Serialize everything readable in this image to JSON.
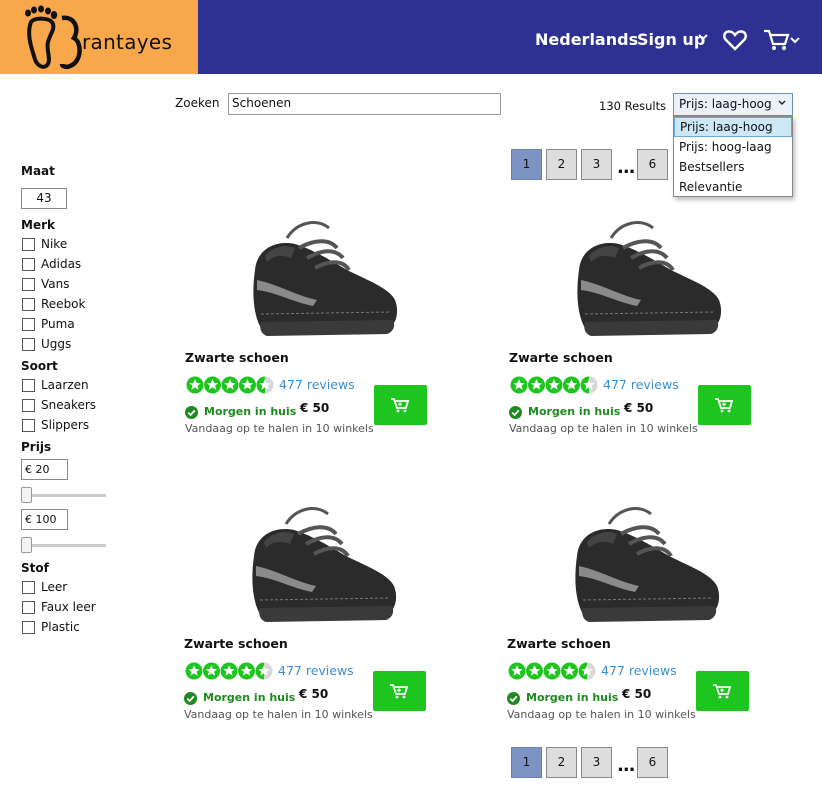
{
  "brand": {
    "name": "Brantayes",
    "letter": "B",
    "rest": "rantayes"
  },
  "nav": {
    "language": "Nederlands",
    "signup": "Sign up"
  },
  "icons": {
    "logo": "feet-logo-icon",
    "heart": "heart-icon",
    "cart": "cart-icon",
    "chevron": "chevron-down-icon",
    "check": "check-circle-icon",
    "star": "star-icon"
  },
  "colors": {
    "header": "#2e3192",
    "logo_bg": "#f8a84a",
    "cart_button": "#1ec51e",
    "star": "#1ec51e",
    "link": "#3a8ed0",
    "delivery": "#1f8a1f",
    "page_active": "#7d93c4"
  },
  "search": {
    "label": "Zoeken",
    "value": "Schoenen"
  },
  "results": {
    "text": "130 Results"
  },
  "sort": {
    "selected": "Prijs: laag-hoog",
    "options": [
      "Prijs: laag-hoog",
      "Prijs: hoog-laag",
      "Bestsellers",
      "Relevantie"
    ]
  },
  "pagination": {
    "pages": [
      "1",
      "2",
      "3",
      "6"
    ],
    "active": "1",
    "ellipsis": "..."
  },
  "filters": {
    "size": {
      "title": "Maat",
      "value": "43"
    },
    "brand": {
      "title": "Merk",
      "options": [
        "Nike",
        "Adidas",
        "Vans",
        "Reebok",
        "Puma",
        "Uggs"
      ]
    },
    "type": {
      "title": "Soort",
      "options": [
        "Laarzen",
        "Sneakers",
        "Slippers"
      ]
    },
    "price": {
      "title": "Prijs",
      "min": "€ 20",
      "max": "€ 100",
      "min_slider": 0,
      "max_slider": 0
    },
    "material": {
      "title": "Stof",
      "options": [
        "Leer",
        "Faux leer",
        "Plastic"
      ]
    }
  },
  "products": [
    {
      "title": "Zwarte schoen",
      "rating": 4.5,
      "reviews": "477 reviews",
      "delivery": "Morgen in huis",
      "price": "€ 50",
      "pickup": "Vandaag op te halen in 10 winkels"
    },
    {
      "title": "Zwarte schoen",
      "rating": 4.5,
      "reviews": "477 reviews",
      "delivery": "Morgen in huis",
      "price": "€ 50",
      "pickup": "Vandaag op te halen in 10 winkels"
    },
    {
      "title": "Zwarte schoen",
      "rating": 4.5,
      "reviews": "477 reviews",
      "delivery": "Morgen in huis",
      "price": "€ 50",
      "pickup": "Vandaag op te halen in 10 winkels"
    },
    {
      "title": "Zwarte schoen",
      "rating": 4.5,
      "reviews": "477 reviews",
      "delivery": "Morgen in huis",
      "price": "€ 50",
      "pickup": "Vandaag op te halen in 10 winkels"
    }
  ]
}
